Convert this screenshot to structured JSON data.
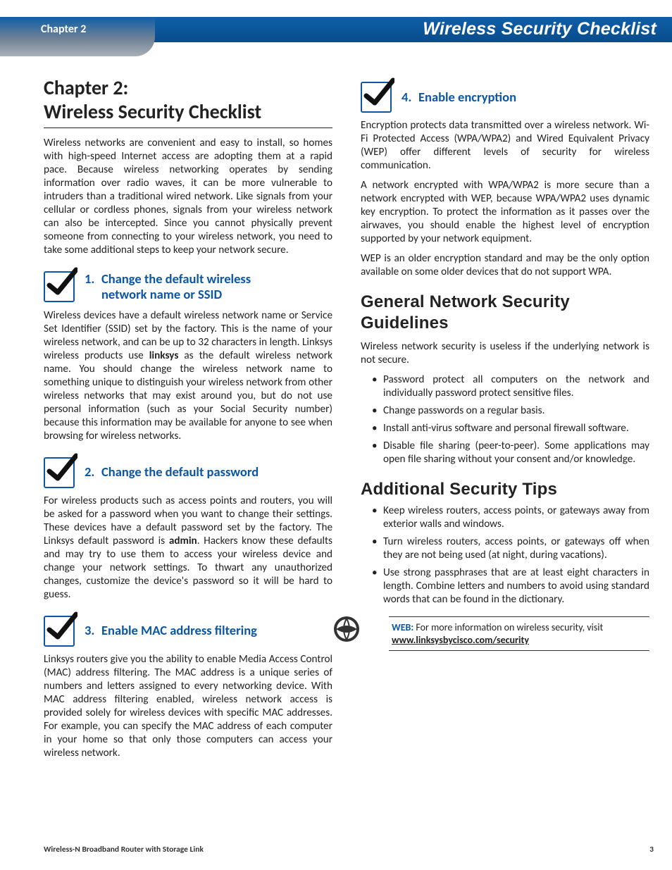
{
  "header": {
    "chapter": "Chapter 2",
    "title": "Wireless Security Checklist"
  },
  "chapterTitleLine1": "Chapter 2:",
  "chapterTitleLine2": "Wireless Security Checklist",
  "intro": "Wireless networks are convenient and easy to install, so homes with high-speed Internet access are adopting them at a rapid pace. Because wireless networking operates by sending information over radio waves, it can be more vulnerable to intruders than a traditional wired network. Like signals from your cellular or cordless phones, signals from your wireless network can also be intercepted. Since you cannot physically prevent someone from connecting to your wireless network, you need to take some additional steps to keep your network secure.",
  "sections": {
    "s1": {
      "num": "1.",
      "titleA": "Change the default wireless",
      "titleB": "network name or SSID",
      "bodyA": "Wireless devices have a default wireless network name or Service Set Identifier (SSID) set by the factory. This is the name of your wireless network, and can be up to 32 characters in length. Linksys wireless products use ",
      "bold": "linksys",
      "bodyB": " as the default wireless network name. You should change the wireless network name to something unique to distinguish your wireless network from other wireless networks that may exist around you, but do not use personal information (such as your Social Security number) because this information may be available for anyone to see when browsing for wireless networks."
    },
    "s2": {
      "num": "2.",
      "title": "Change the default password",
      "bodyA": "For wireless products such as access points and routers, you will be asked for a password when you want to change their settings. These devices have a default password set by the factory. The Linksys default password is ",
      "bold": "admin",
      "bodyB": ". Hackers know these defaults and may try to use them to access your wireless device and change your network settings. To thwart any unauthorized changes, customize the device's password so it will be hard to guess."
    },
    "s3": {
      "num": "3.",
      "title": "Enable MAC address filtering",
      "body": "Linksys routers give you the ability to enable Media Access Control (MAC) address filtering. The MAC address is a unique series of numbers and letters assigned to every networking device. With MAC address filtering enabled, wireless network access is provided solely for wireless devices with specific MAC addresses. For example, you can specify the MAC address of each computer in your home so that only those computers can access your wireless network."
    },
    "s4": {
      "num": "4.",
      "title": "Enable encryption",
      "p1": "Encryption protects data transmitted over a wireless network. Wi-Fi Protected Access (WPA/WPA2) and Wired Equivalent Privacy (WEP) offer different levels of security for wireless communication.",
      "p2": "A network encrypted with WPA/WPA2 is more secure than a network encrypted with WEP, because WPA/WPA2 uses dynamic key encryption. To protect the information as it passes over the airwaves, you should enable the highest level of encryption supported by your network equipment.",
      "p3": "WEP is an older encryption standard and may be the only option available on some older devices that do not support WPA."
    }
  },
  "general": {
    "heading": "General Network Security Guidelines",
    "intro": "Wireless network security is useless if the underlying network is not secure.",
    "items": [
      "Password protect all computers on the network and individually password protect sensitive files.",
      "Change passwords on a regular basis.",
      "Install anti-virus software and personal firewall software.",
      "Disable file sharing (peer-to-peer). Some applications may open file sharing without your consent and/or knowledge."
    ]
  },
  "additional": {
    "heading": "Additional Security Tips",
    "items": [
      "Keep wireless routers, access points, or gateways away from exterior walls and windows.",
      "Turn wireless routers, access points, or gateways off when they are not being used (at night, during vacations).",
      "Use strong passphrases that are at least eight characters in length. Combine letters and numbers to avoid using standard words that can be found in the dictionary."
    ]
  },
  "note": {
    "label": "WEB:",
    "text": " For more information on wireless security, visit ",
    "link": "www.linksysbycisco.com/security"
  },
  "footer": {
    "left": "Wireless-N Broadband Router with Storage Link",
    "right": "3"
  }
}
